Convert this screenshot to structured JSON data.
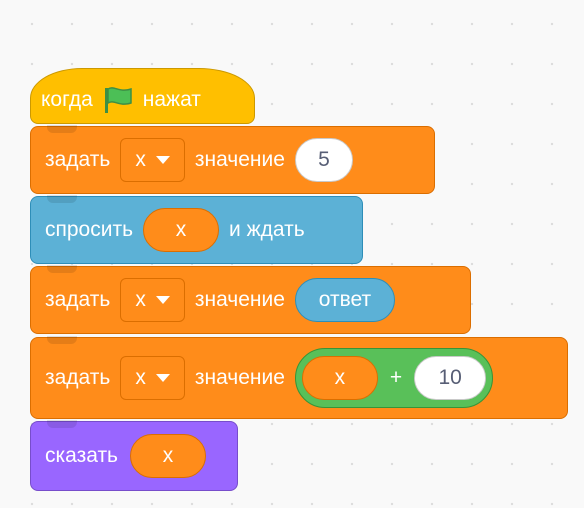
{
  "colors": {
    "events": "#ffbf00",
    "variables": "#ff8c1a",
    "sensing": "#5cb1d6",
    "looks": "#9966ff",
    "operators": "#59c059",
    "flag": "#4cbf56"
  },
  "script": {
    "hat": {
      "when_label": "когда",
      "icon": "green-flag-icon",
      "clicked_label": "нажат"
    },
    "set1": {
      "set_label": "задать",
      "variable": "x",
      "to_label": "значение",
      "value": "5"
    },
    "ask": {
      "ask_label": "спросить",
      "variable": "x",
      "wait_label": "и ждать"
    },
    "set2": {
      "set_label": "задать",
      "variable": "x",
      "to_label": "значение",
      "reporter": "ответ"
    },
    "set3": {
      "set_label": "задать",
      "variable": "x",
      "to_label": "значение",
      "operand_a": "x",
      "operator": "+",
      "operand_b": "10"
    },
    "say": {
      "say_label": "сказать",
      "variable": "x"
    }
  }
}
